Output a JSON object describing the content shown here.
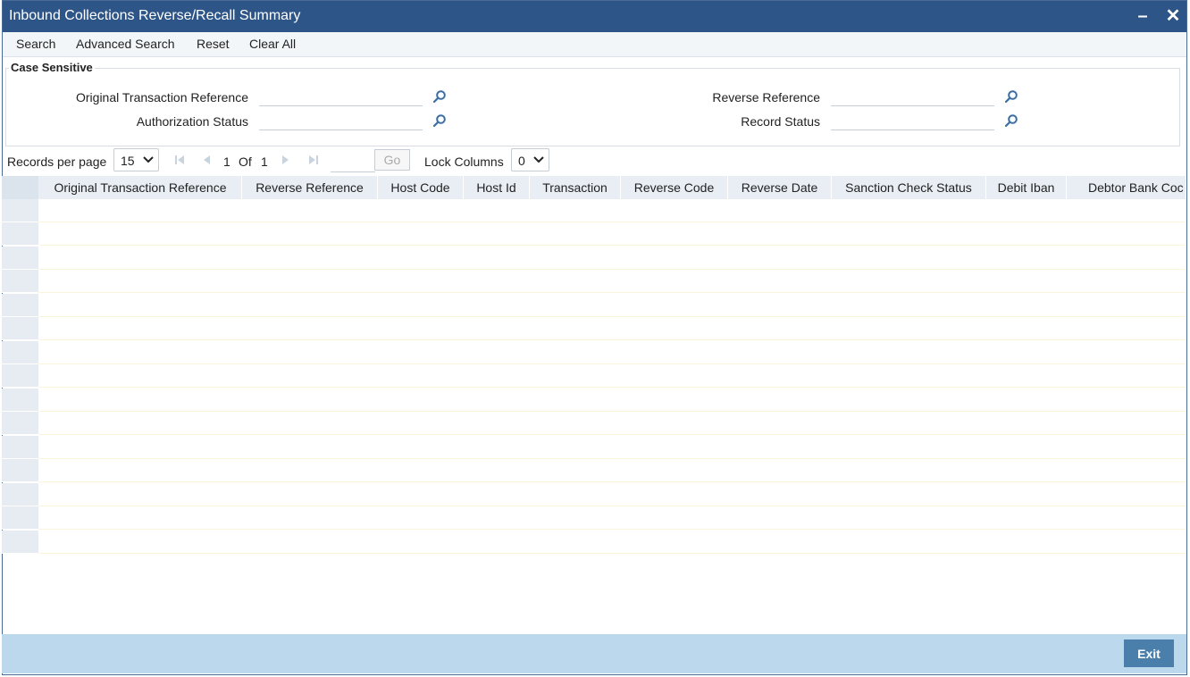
{
  "window": {
    "title": "Inbound Collections Reverse/Recall Summary",
    "minimize_symbol": "–",
    "close_symbol": "✕"
  },
  "toolbar": {
    "search": "Search",
    "advanced_search": "Advanced Search",
    "reset": "Reset",
    "clear_all": "Clear All"
  },
  "criteria": {
    "legend": "Case Sensitive",
    "original_transaction_reference": {
      "label": "Original Transaction Reference",
      "value": ""
    },
    "authorization_status": {
      "label": "Authorization Status",
      "value": ""
    },
    "reverse_reference": {
      "label": "Reverse Reference",
      "value": ""
    },
    "record_status": {
      "label": "Record Status",
      "value": ""
    }
  },
  "pager": {
    "records_per_page_label": "Records per page",
    "records_per_page": "15",
    "current_page": "1",
    "of_label": "Of",
    "total_pages": "1",
    "goto_value": "",
    "go_label": "Go",
    "lock_columns_label": "Lock Columns",
    "lock_columns": "0"
  },
  "grid": {
    "columns": [
      "Original Transaction Reference",
      "Reverse Reference",
      "Host Code",
      "Host Id",
      "Transaction",
      "Reverse Code",
      "Reverse Date",
      "Sanction Check Status",
      "Debit Iban",
      "Debtor Bank Coc"
    ],
    "rows": []
  },
  "footer": {
    "exit_label": "Exit"
  },
  "colors": {
    "titlebar": "#2d5587",
    "footer": "#bcd8ec",
    "exit_button": "#4b7fab",
    "grid_header": "#e9eef4"
  },
  "icons": {
    "lookup": "magnifier-icon",
    "first": "first-page-icon",
    "prev": "prev-page-icon",
    "next": "next-page-icon",
    "last": "last-page-icon",
    "dropdown": "chevron-down-icon"
  }
}
